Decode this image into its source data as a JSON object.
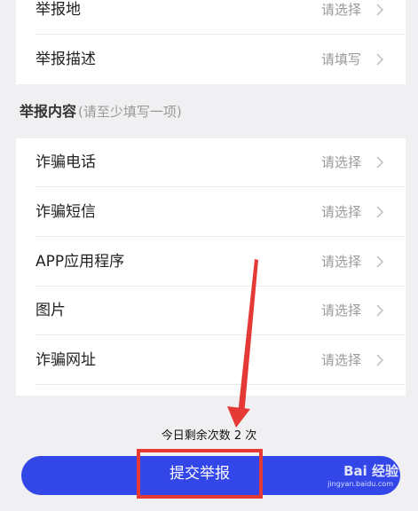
{
  "basic_rows": [
    {
      "label": "举报地",
      "value": "请选择"
    },
    {
      "label": "举报描述",
      "value": "请填写"
    }
  ],
  "content_section": {
    "title": "举报内容",
    "hint": "(请至少填写一项)"
  },
  "content_rows": [
    {
      "label": "诈骗电话",
      "value": "请选择"
    },
    {
      "label": "诈骗短信",
      "value": "请选择"
    },
    {
      "label": "APP应用程序",
      "value": "请选择"
    },
    {
      "label": "图片",
      "value": "请选择"
    },
    {
      "label": "诈骗网址",
      "value": "请选择"
    }
  ],
  "footer": {
    "remaining_text": "今日剩余次数 2 次",
    "submit_label": "提交举报"
  },
  "watermark": {
    "logo_text": "Bai 经验",
    "url_text": "jingyan.baidu.com"
  },
  "colors": {
    "accent": "#3346e8",
    "annotation": "#e53935",
    "muted": "#9a9a9a"
  },
  "icons": {
    "row_chevron": "chevron-right-icon",
    "annotation_arrow": "red-arrow-annotation"
  }
}
